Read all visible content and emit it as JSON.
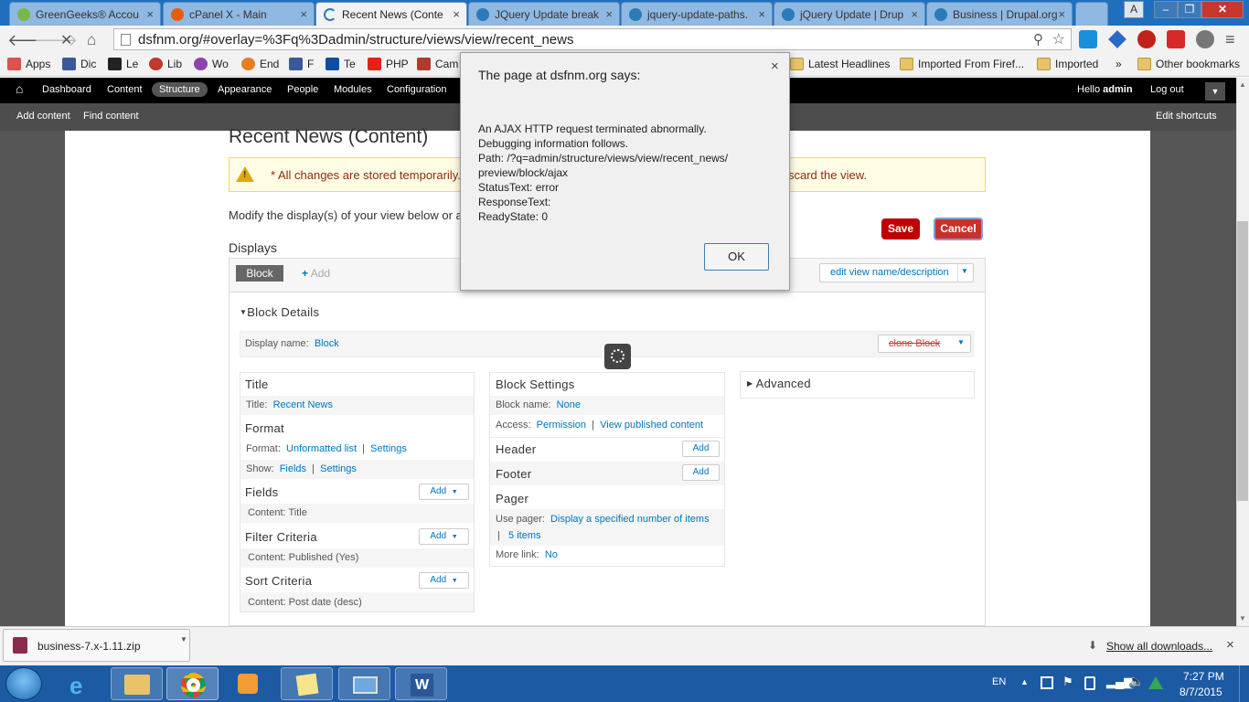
{
  "browser": {
    "tabs": [
      {
        "title": "GreenGeeks® Accou",
        "favicon": "greengeeks-icon"
      },
      {
        "title": "cPanel X - Main",
        "favicon": "cpanel-icon"
      },
      {
        "title": "Recent News (Conte",
        "favicon": "loading-icon",
        "active": true
      },
      {
        "title": "JQuery Update break",
        "favicon": "drupal-icon"
      },
      {
        "title": "jquery-update-paths.",
        "favicon": "drupal-icon"
      },
      {
        "title": "jQuery Update | Drup",
        "favicon": "drupal-icon"
      },
      {
        "title": "Business | Drupal.org",
        "favicon": "drupal-icon"
      }
    ],
    "url": "dsfnm.org/#overlay=%3Fq%3Dadmin/structure/views/view/recent_news",
    "bookmarks": [
      {
        "label": "Apps",
        "color": "#d9534f"
      },
      {
        "label": "Dic",
        "color": "#3b5998"
      },
      {
        "label": "Le",
        "color": "#222222"
      },
      {
        "label": "Lib",
        "color": "#c0392b"
      },
      {
        "label": "Wo",
        "color": "#8e44ad"
      },
      {
        "label": "End",
        "color": "#e67e22"
      },
      {
        "label": "F",
        "color": "#3b5998"
      },
      {
        "label": "Te",
        "color": "#0b4ea2"
      },
      {
        "label": "PHP",
        "color": "#e62117"
      },
      {
        "label": "Cam",
        "color": "#b03a2e"
      }
    ],
    "bookmark_folders": [
      "Latest Headlines",
      "Imported From Firef...",
      "Imported"
    ],
    "bookmarks_more": "»",
    "other_bookmarks": "Other bookmarks"
  },
  "drupal": {
    "toolbar": {
      "home": "⌂",
      "items": [
        "Dashboard",
        "Content",
        "Structure",
        "Appearance",
        "People",
        "Modules",
        "Configuration"
      ],
      "active": "Structure",
      "hello": "Hello",
      "user": "admin",
      "logout": "Log out"
    },
    "shortcuts": {
      "add": "Add content",
      "find": "Find content",
      "edit": "Edit shortcuts"
    },
    "page_title": "Recent News (Content)",
    "warning_left": "* All changes are stored temporarily.",
    "warning_right": "scard the view.",
    "intro": "Modify the display(s) of your view below or a",
    "save": "Save",
    "cancel": "Cancel",
    "displays_label": "Displays",
    "display_tab": "Block",
    "add_display": "Add",
    "edit_view_name": "edit view name/description",
    "block_details": "Block Details",
    "display_name_label": "Display name:",
    "display_name_value": "Block",
    "clone_block": "clone Block",
    "title_section": {
      "heading": "Title",
      "label": "Title:",
      "value": "Recent News"
    },
    "format_section": {
      "heading": "Format",
      "format_label": "Format:",
      "format_value": "Unformatted list",
      "format_settings": "Settings",
      "show_label": "Show:",
      "show_value": "Fields",
      "show_settings": "Settings"
    },
    "fields_section": {
      "heading": "Fields",
      "add": "Add",
      "item": "Content: Title"
    },
    "filter_section": {
      "heading": "Filter Criteria",
      "add": "Add",
      "item": "Content: Published (Yes)"
    },
    "sort_section": {
      "heading": "Sort Criteria",
      "add": "Add",
      "item": "Content: Post date (desc)"
    },
    "block_settings": {
      "heading": "Block Settings",
      "name_label": "Block name:",
      "name_value": "None",
      "access_label": "Access:",
      "access_value": "Permission",
      "access_detail": "View published content",
      "header": "Header",
      "header_add": "Add",
      "footer": "Footer",
      "footer_add": "Add",
      "pager": "Pager",
      "use_pager_label": "Use pager:",
      "use_pager_value": "Display a specified number of items",
      "items": "5 items",
      "more_label": "More link:",
      "more_value": "No"
    },
    "advanced": "Advanced"
  },
  "dialog": {
    "title": "The page at dsfnm.org says:",
    "lines": [
      "An AJAX HTTP request terminated abnormally.",
      "Debugging information follows.",
      "Path: /?q=admin/structure/views/view/recent_news/",
      "preview/block/ajax",
      "StatusText: error",
      "ResponseText:",
      "ReadyState: 0"
    ],
    "ok": "OK",
    "close": "×"
  },
  "downloads": {
    "file": "business-7.x-1.11.zip",
    "show_all": "Show all downloads...",
    "close": "×"
  },
  "taskbar": {
    "lang": "EN",
    "time": "7:27 PM",
    "date": "8/7/2015"
  },
  "colors": {
    "save": "#c00000",
    "cancel": "#c00000",
    "warning_bg": "#fffce5",
    "link": "#0074bd"
  }
}
